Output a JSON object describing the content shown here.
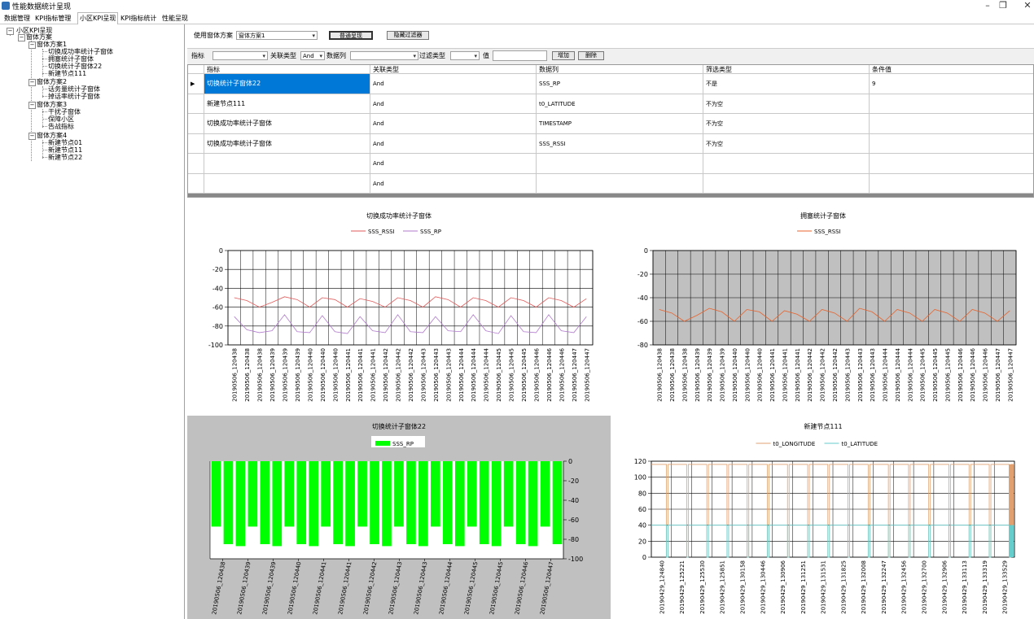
{
  "window": {
    "title": "性能数据统计呈现",
    "controls": [
      "–",
      "❐",
      "✕"
    ]
  },
  "tabs": [
    {
      "label": "数据管理",
      "active": false
    },
    {
      "label": "KPI指标管理",
      "active": false
    },
    {
      "label": "小区KPI呈现",
      "active": true
    },
    {
      "label": "KPI指标统计",
      "active": false
    },
    {
      "label": "性能呈现",
      "active": false
    }
  ],
  "tree": {
    "root": "小区KPI呈现",
    "group": "窗体方案",
    "schemes": [
      {
        "name": "窗体方案1",
        "children": [
          "切换成功率统计子窗体",
          "拥塞统计子窗体",
          "切换统计子窗体22",
          "新建节点111"
        ]
      },
      {
        "name": "窗体方案2",
        "children": [
          "话务量统计子窗体",
          "掉话率统计子窗体"
        ]
      },
      {
        "name": "窗体方案3",
        "children": [
          "干扰子窗体",
          "保障小区",
          "告战指标"
        ]
      },
      {
        "name": "窗体方案4",
        "children": [
          "新建节点01",
          "新建节点11",
          "新建节点22"
        ]
      }
    ]
  },
  "toolbar": {
    "scheme_label": "使用窗体方案",
    "scheme_value": "窗体方案1",
    "save_button": "普通呈现",
    "filter_button": "隐藏过滤器"
  },
  "filter": {
    "metric_label": "指标",
    "relation_label": "关联类型",
    "relation_value": "And",
    "datacol_label": "数据列",
    "filtertype_label": "过滤类型",
    "value_label": "值",
    "add_button": "增加",
    "delete_button": "删除"
  },
  "grid": {
    "headers": [
      "指标",
      "关联类型",
      "数据列",
      "筛选类型",
      "条件值"
    ],
    "rows": [
      [
        "切换统计子窗体22",
        "And",
        "SSS_RP",
        "不是",
        "9"
      ],
      [
        "新建节点111",
        "And",
        "t0_LATITUDE",
        "不为空",
        ""
      ],
      [
        "切换成功率统计子窗体",
        "And",
        "TIMESTAMP",
        "不为空",
        ""
      ],
      [
        "切换成功率统计子窗体",
        "And",
        "SSS_RSSI",
        "不为空",
        ""
      ],
      [
        "",
        "And",
        "",
        "",
        ""
      ],
      [
        "",
        "And",
        "",
        "",
        ""
      ]
    ]
  },
  "charts": {
    "chart1": {
      "title": "切换成功率统计子窗体",
      "legend": [
        "SSS_RSSI",
        "SSS_RP"
      ],
      "colors": [
        "#e05a5a",
        "#b07acc"
      ]
    },
    "chart2": {
      "title": "拥塞统计子窗体",
      "legend": [
        "SSS_RSSI"
      ],
      "colors": [
        "#e8632c"
      ]
    },
    "chart3": {
      "title": "切换统计子窗体22",
      "legend": [
        "SSS_RP"
      ],
      "colors": [
        "#00ff00"
      ]
    },
    "chart4": {
      "title": "新建节点111",
      "legend": [
        "t0_LONGITUDE",
        "t0_LATITUDE"
      ],
      "colors": [
        "#e0a070",
        "#66cccc"
      ]
    }
  },
  "chart_data": [
    {
      "type": "line",
      "title": "切换成功率统计子窗体",
      "x": [
        "20190506_120438",
        "20190506_120438",
        "20190506_120438",
        "20190506_120439",
        "20190506_120439",
        "20190506_120439",
        "20190506_120440",
        "20190506_120440",
        "20190506_120440",
        "20190506_120441",
        "20190506_120441",
        "20190506_120441",
        "20190506_120442",
        "20190506_120442",
        "20190506_120442",
        "20190506_120443",
        "20190506_120443",
        "20190506_120443",
        "20190506_120444",
        "20190506_120444",
        "20190506_120444",
        "20190506_120445",
        "20190506_120445",
        "20190506_120445",
        "20190506_120446",
        "20190506_120446",
        "20190506_120446",
        "20190506_120447",
        "20190506_120447"
      ],
      "ylim": [
        -100,
        0
      ],
      "yticks": [
        0,
        -20,
        -40,
        -60,
        -80,
        -100
      ],
      "series": [
        {
          "name": "SSS_RSSI",
          "values": [
            -50,
            -53,
            -60,
            -55,
            -49,
            -52,
            -60,
            -50,
            -52,
            -60,
            -51,
            -54,
            -60,
            -50,
            -53,
            -60,
            -49,
            -52,
            -60,
            -50,
            -53,
            -60,
            -50,
            -53,
            -60,
            -50,
            -53,
            -60,
            -51
          ]
        },
        {
          "name": "SSS_RP",
          "values": [
            -70,
            -84,
            -87,
            -85,
            -68,
            -86,
            -87,
            -69,
            -86,
            -88,
            -70,
            -85,
            -87,
            -68,
            -86,
            -87,
            -70,
            -85,
            -86,
            -68,
            -85,
            -88,
            -69,
            -86,
            -87,
            -68,
            -85,
            -87,
            -70
          ]
        }
      ]
    },
    {
      "type": "line",
      "title": "拥塞统计子窗体",
      "x": [
        "20190506_120438",
        "20190506_120438",
        "20190506_120438",
        "20190506_120439",
        "20190506_120439",
        "20190506_120439",
        "20190506_120440",
        "20190506_120440",
        "20190506_120440",
        "20190506_120441",
        "20190506_120441",
        "20190506_120441",
        "20190506_120442",
        "20190506_120442",
        "20190506_120442",
        "20190506_120443",
        "20190506_120443",
        "20190506_120443",
        "20190506_120444",
        "20190506_120444",
        "20190506_120444",
        "20190506_120445",
        "20190506_120445",
        "20190506_120445",
        "20190506_120446",
        "20190506_120446",
        "20190506_120446",
        "20190506_120447",
        "20190506_120447"
      ],
      "ylim": [
        -80,
        0
      ],
      "yticks": [
        0,
        -20,
        -40,
        -60,
        -80
      ],
      "series": [
        {
          "name": "SSS_RSSI",
          "values": [
            -50,
            -53,
            -60,
            -55,
            -49,
            -52,
            -60,
            -50,
            -52,
            -60,
            -51,
            -54,
            -60,
            -50,
            -53,
            -60,
            -49,
            -52,
            -60,
            -50,
            -53,
            -60,
            -50,
            -53,
            -60,
            -50,
            -53,
            -60,
            -51
          ]
        }
      ]
    },
    {
      "type": "bar",
      "title": "切换统计子窗体22",
      "categories": [
        "20190506_120438",
        "20190506_120439",
        "20190506_120439",
        "20190506_120440",
        "20190506_120441",
        "20190506_120441",
        "20190506_120442",
        "20190506_120443",
        "20190506_120443",
        "20190506_120444",
        "20190506_120445",
        "20190506_120445",
        "20190506_120446",
        "20190506_120447"
      ],
      "ylim": [
        -100,
        0
      ],
      "yticks": [
        0,
        -20,
        -40,
        -60,
        -80,
        -100
      ],
      "series": [
        {
          "name": "SSS_RP",
          "values": [
            -67,
            -85,
            -87,
            -67,
            -85,
            -87,
            -67,
            -85,
            -87,
            -67,
            -85,
            -87,
            -67,
            -85,
            -87,
            -67,
            -85,
            -87,
            -67,
            -85,
            -87,
            -67,
            -85,
            -87,
            -67,
            -85,
            -87,
            -67,
            -85
          ]
        }
      ]
    },
    {
      "type": "line",
      "title": "新建节点111",
      "x": [
        "20190429_124840",
        "20190429_125221",
        "20190429_125530",
        "20190429_125851",
        "20190429_130158",
        "20190429_130446",
        "20190429_130906",
        "20190429_131251",
        "20190429_131531",
        "20190429_131825",
        "20190429_132008",
        "20190429_132247",
        "20190429_132456",
        "20190429_132700",
        "20190429_132906",
        "20190429_133113",
        "20190429_133319",
        "20190429_133529"
      ],
      "ylim": [
        0,
        120
      ],
      "yticks": [
        120,
        100,
        80,
        60,
        40,
        20,
        0
      ],
      "series": [
        {
          "name": "t0_LONGITUDE",
          "values": [
            116,
            0,
            116,
            0,
            116,
            0,
            116,
            0,
            116,
            0,
            116,
            0,
            116,
            0,
            116,
            0,
            116,
            116
          ]
        },
        {
          "name": "t0_LATITUDE",
          "values": [
            40,
            0,
            40,
            0,
            40,
            0,
            40,
            0,
            40,
            0,
            40,
            0,
            40,
            0,
            40,
            0,
            40,
            40
          ]
        }
      ]
    }
  ]
}
